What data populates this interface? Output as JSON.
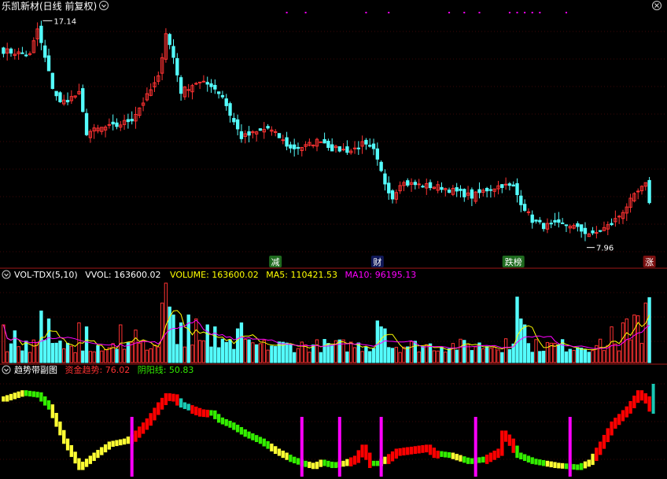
{
  "window": {
    "title": "乐凯新材(日线 前复权)",
    "close_icon": "close-circle-icon",
    "dropdown_icon": "chevron-down-icon"
  },
  "colors": {
    "background": "#000000",
    "up": "#ff3232",
    "down": "#54fcfc",
    "grid": "#7a1010",
    "frame": "#a01818",
    "white": "#ffffff",
    "yellow": "#ffff00",
    "magenta": "#ff00ff",
    "green": "#00e000",
    "trend_red": "#ff0000",
    "trend_green": "#33ee00",
    "trend_yellow": "#ffff33",
    "trend_cyan": "#19c8b4"
  },
  "price_panel": {
    "high_label": "17.14",
    "low_label": "7.96",
    "events": [
      {
        "label": "减",
        "bg": "#1f6b1f",
        "fg": "#ffffff",
        "index": 72
      },
      {
        "label": "财",
        "bg": "#101858",
        "fg": "#ffffff",
        "index": 99
      },
      {
        "label": "跌榜",
        "bg": "#1f6b1f",
        "fg": "#ffffff",
        "index": 135
      },
      {
        "label": "涨",
        "bg": "#7a1010",
        "fg": "#ffffff",
        "index": 171
      }
    ]
  },
  "volume_panel": {
    "indicator_name": "VOL-TDX(5,10)",
    "vvol_label": "VVOL: 163600.02",
    "volume_label": "VOLUME: 163600.02",
    "ma5_label": "MA5: 110421.53",
    "ma10_label": "MA10: 96195.13"
  },
  "trend_panel": {
    "indicator_name": "趋势带副图",
    "fund_label": "资金趋势: 76.02",
    "yinyang_label": "阴阳线: 50.83"
  },
  "chart_data": [
    {
      "type": "candlestick",
      "name": "乐凯新材(日线 前复权)",
      "count": 172,
      "price_high": 17.14,
      "price_low": 7.96,
      "ylim": [
        7.2,
        17.8
      ],
      "anchors": [
        [
          0,
          16.2
        ],
        [
          7,
          16.0
        ],
        [
          9,
          17.14
        ],
        [
          13,
          14.6
        ],
        [
          15,
          13.9
        ],
        [
          20,
          14.3
        ],
        [
          22,
          12.6
        ],
        [
          26,
          12.8
        ],
        [
          30,
          12.9
        ],
        [
          34,
          13.2
        ],
        [
          38,
          14.2
        ],
        [
          41,
          15.0
        ],
        [
          43,
          17.0
        ],
        [
          45,
          15.9
        ],
        [
          47,
          14.4
        ],
        [
          51,
          14.8
        ],
        [
          55,
          14.7
        ],
        [
          58,
          14.2
        ],
        [
          60,
          13.4
        ],
        [
          63,
          12.4
        ],
        [
          67,
          12.6
        ],
        [
          70,
          12.8
        ],
        [
          73,
          12.4
        ],
        [
          76,
          11.9
        ],
        [
          80,
          12.0
        ],
        [
          84,
          12.3
        ],
        [
          87,
          11.9
        ],
        [
          92,
          11.8
        ],
        [
          95,
          12.1
        ],
        [
          98,
          11.8
        ],
        [
          101,
          10.4
        ],
        [
          103,
          9.75
        ],
        [
          105,
          10.4
        ],
        [
          110,
          10.3
        ],
        [
          116,
          10.2
        ],
        [
          120,
          10.0
        ],
        [
          124,
          9.8
        ],
        [
          128,
          10.1
        ],
        [
          132,
          10.3
        ],
        [
          135,
          10.2
        ],
        [
          137,
          9.55
        ],
        [
          140,
          8.75
        ],
        [
          143,
          8.5
        ],
        [
          146,
          8.55
        ],
        [
          150,
          8.55
        ],
        [
          153,
          8.3
        ],
        [
          156,
          8.1
        ],
        [
          158,
          8.3
        ],
        [
          161,
          8.6
        ],
        [
          163,
          8.95
        ],
        [
          166,
          9.6
        ],
        [
          168,
          10.0
        ],
        [
          170,
          10.3
        ],
        [
          171,
          9.6
        ]
      ]
    },
    {
      "type": "bar",
      "name": "VOLUME",
      "count": 172,
      "ylim": [
        0,
        200000
      ],
      "last_value": 163600.02,
      "ma5_last": 110421.53,
      "ma10_last": 96195.13,
      "base": 50000,
      "spikes": {
        "0": 95000,
        "3": 80000,
        "10": 130000,
        "12": 110000,
        "20": 100000,
        "22": 90000,
        "31": 95000,
        "35": 82000,
        "42": 150000,
        "43": 200000,
        "44": 140000,
        "45": 120000,
        "47": 100000,
        "49": 120000,
        "51": 110000,
        "54": 95000,
        "56": 90000,
        "62": 85000,
        "63": 100000,
        "99": 105000,
        "100": 90000,
        "101": 85000,
        "133": 60000,
        "136": 165000,
        "137": 110000,
        "138": 95000,
        "161": 90000,
        "164": 100000,
        "165": 110000,
        "167": 120000,
        "168": 118000,
        "170": 150000,
        "171": 188000
      }
    },
    {
      "type": "bar",
      "name": "资金趋势",
      "count": 172,
      "ylim": [
        0,
        100
      ],
      "last_fund_value": 76.02,
      "last_yinyang_value": 50.83,
      "anchors": [
        [
          0,
          80
        ],
        [
          5,
          86
        ],
        [
          9,
          84
        ],
        [
          12,
          72
        ],
        [
          16,
          38
        ],
        [
          20,
          12
        ],
        [
          24,
          24
        ],
        [
          28,
          35
        ],
        [
          32,
          38
        ],
        [
          34,
          42
        ],
        [
          38,
          58
        ],
        [
          41,
          74
        ],
        [
          43,
          83
        ],
        [
          45,
          82
        ],
        [
          47,
          74
        ],
        [
          52,
          67
        ],
        [
          55,
          66
        ],
        [
          57,
          59
        ],
        [
          60,
          54
        ],
        [
          64,
          45
        ],
        [
          68,
          38
        ],
        [
          72,
          28
        ],
        [
          76,
          20
        ],
        [
          79,
          16
        ],
        [
          82,
          13
        ],
        [
          84,
          17
        ],
        [
          87,
          14
        ],
        [
          90,
          16
        ],
        [
          93,
          21
        ],
        [
          95,
          32
        ],
        [
          97,
          16
        ],
        [
          99,
          16
        ],
        [
          101,
          20
        ],
        [
          104,
          28
        ],
        [
          108,
          30
        ],
        [
          112,
          32
        ],
        [
          114,
          26
        ],
        [
          118,
          24
        ],
        [
          123,
          18
        ],
        [
          127,
          20
        ],
        [
          131,
          28
        ],
        [
          132,
          46
        ],
        [
          134,
          38
        ],
        [
          136,
          24
        ],
        [
          140,
          18
        ],
        [
          146,
          14
        ],
        [
          152,
          12
        ],
        [
          155,
          17
        ],
        [
          158,
          35
        ],
        [
          161,
          55
        ],
        [
          165,
          70
        ],
        [
          168,
          86
        ],
        [
          170,
          80
        ],
        [
          171,
          72
        ]
      ],
      "colors_segments": [
        [
          0,
          5,
          "yellow"
        ],
        [
          6,
          12,
          "green"
        ],
        [
          13,
          22,
          "yellow"
        ],
        [
          23,
          33,
          "yellow"
        ],
        [
          34,
          35,
          "red"
        ],
        [
          36,
          40,
          "red"
        ],
        [
          41,
          46,
          "red"
        ],
        [
          47,
          49,
          "cyan"
        ],
        [
          50,
          54,
          "red"
        ],
        [
          55,
          60,
          "green"
        ],
        [
          61,
          70,
          "green"
        ],
        [
          71,
          75,
          "yellow"
        ],
        [
          76,
          80,
          "green"
        ],
        [
          81,
          84,
          "yellow"
        ],
        [
          85,
          88,
          "green"
        ],
        [
          89,
          91,
          "yellow"
        ],
        [
          92,
          97,
          "red"
        ],
        [
          98,
          99,
          "green"
        ],
        [
          100,
          101,
          "yellow"
        ],
        [
          102,
          115,
          "red"
        ],
        [
          116,
          118,
          "green"
        ],
        [
          119,
          121,
          "yellow"
        ],
        [
          122,
          127,
          "green"
        ],
        [
          128,
          135,
          "red"
        ],
        [
          136,
          143,
          "green"
        ],
        [
          144,
          148,
          "yellow"
        ],
        [
          149,
          153,
          "green"
        ],
        [
          154,
          156,
          "yellow"
        ],
        [
          157,
          171,
          "red"
        ]
      ],
      "markers": [
        34,
        79,
        89,
        100,
        125,
        150
      ]
    }
  ]
}
